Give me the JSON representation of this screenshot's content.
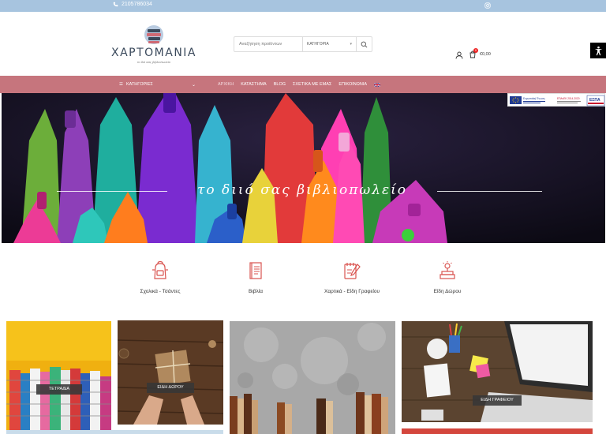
{
  "topbar": {
    "phone": "2105786034",
    "phone_icon": "phone-icon",
    "social_icon": "instagram-icon"
  },
  "header": {
    "logo_name": "ΧΑΡΤΟΜΑΝΙΑ",
    "logo_tagline": "το διό σας βιβλιοπωλείο",
    "search": {
      "placeholder": "Αναζήτηση προϊόντων",
      "category": "ΚΑΤΗΓΟΡΙΑ",
      "icon": "search-icon"
    },
    "account_icon": "user-icon",
    "cart": {
      "badge": "0",
      "total": "€0,00",
      "icon": "cart-icon"
    },
    "accessibility_icon": "accessibility-icon"
  },
  "nav": {
    "categories": "ΚΑΤΗΓΟΡΙΕΣ",
    "items": [
      "ΑΡΧΙΚΗ",
      "ΚΑΤΑΣΤΗΜΑ",
      "BLOG",
      "ΣΧΕΤΙΚΑ ΜΕ ΕΜΑΣ",
      "ΕΠΙΚΟΙΝΩΝΙΑ"
    ],
    "language_flag": "uk-flag-icon"
  },
  "hero": {
    "slogan": "το διιό σας βιβλιοπωλείο"
  },
  "espa_banner": {
    "eu_text": "Ευρωπαϊκή Ένωση",
    "espa_text": "ΕΣΠΑ",
    "program_text": "ΕΠΑνΕΚ 2014-2020"
  },
  "categories": [
    {
      "label": "Σχολικά - Τσάντες",
      "icon": "backpack-icon"
    },
    {
      "label": "Βιβλία",
      "icon": "book-icon"
    },
    {
      "label": "Χαρτικά - Είδη Γραφείου",
      "icon": "notepad-pencil-icon"
    },
    {
      "label": "Είδη Δώρου",
      "icon": "gift-lamp-icon"
    }
  ],
  "tiles": [
    {
      "label": "ΤΕΤΡΑΔΙΑ"
    },
    {
      "label": "ΕΙΔΗ ΔΩΡΟΥ"
    },
    {
      "label": ""
    },
    {
      "label": "ΕΙΔΗ ΓΡΑΦΕΙΟΥ"
    }
  ],
  "colors": {
    "topbar": "#a7c4df",
    "nav": "#c6757d",
    "accent": "#d9534f"
  }
}
